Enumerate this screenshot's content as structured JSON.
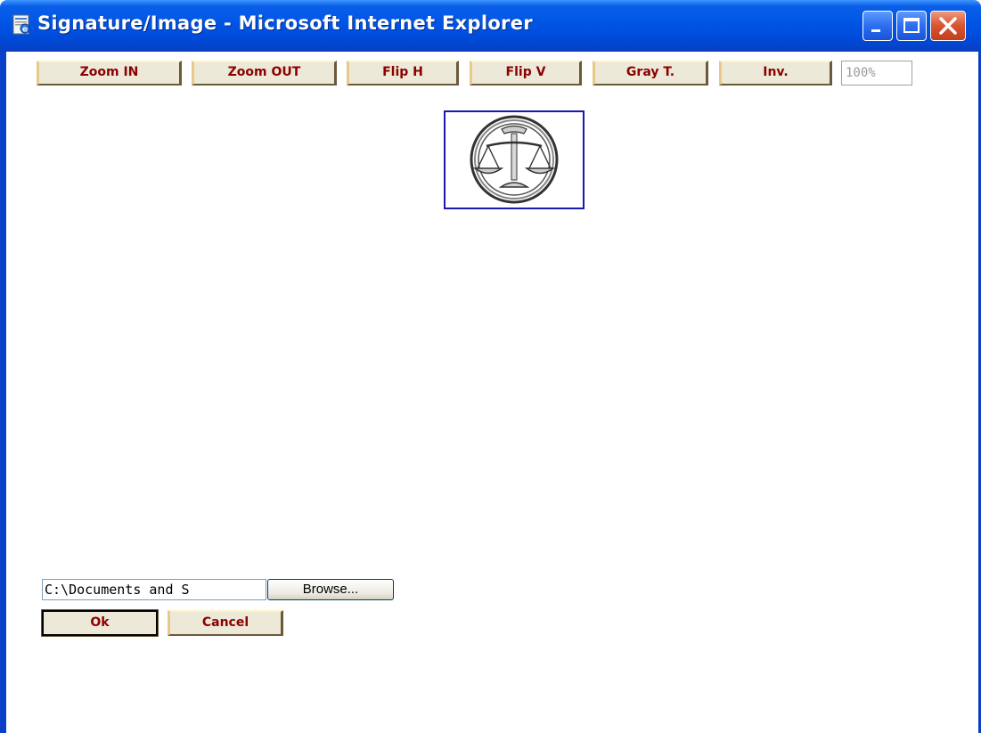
{
  "window": {
    "title": "Signature/Image - Microsoft Internet Explorer"
  },
  "toolbar": {
    "buttons": [
      {
        "label": "Zoom IN"
      },
      {
        "label": "Zoom OUT"
      },
      {
        "label": "Flip H"
      },
      {
        "label": "Flip V"
      },
      {
        "label": "Gray T."
      },
      {
        "label": "Inv."
      }
    ],
    "zoom_value": "100%"
  },
  "image": {
    "icon": "scales-of-justice-seal-icon"
  },
  "form": {
    "file_path": "C:\\Documents and S",
    "browse_label": "Browse...",
    "ok_label": "Ok",
    "cancel_label": "Cancel"
  },
  "colors": {
    "button_text": "#8b0000",
    "titlebar": "#0055e5",
    "image_border": "#1a1aa8"
  }
}
